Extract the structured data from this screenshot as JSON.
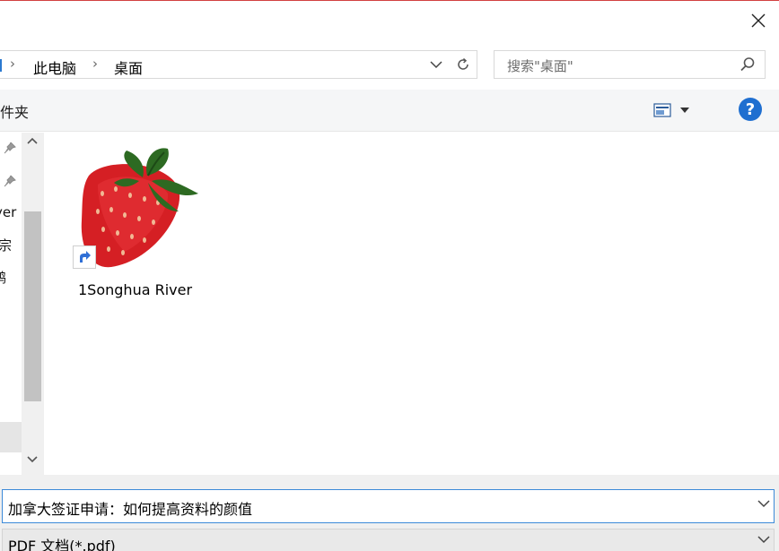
{
  "window": {
    "close_label": "×"
  },
  "address_bar": {
    "breadcrumbs": [
      "此电脑",
      "桌面"
    ]
  },
  "search": {
    "placeholder": "搜索\"桌面\""
  },
  "toolbar": {
    "new_folder_label": "件夹",
    "help_label": "?"
  },
  "nav": {
    "items": [
      "yer",
      "宗",
      "鸭"
    ]
  },
  "files": [
    {
      "name": "1Songhua River",
      "icon": "strawberry-image-icon",
      "is_shortcut": true
    }
  ],
  "bottom": {
    "filename_value": "加拿大签证申请：如何提高资料的颜值",
    "filetype_value": "PDF 文档(*.pdf)"
  },
  "colors": {
    "accent": "#1f6fd0",
    "input_focus_border": "#3c8ad8",
    "title_top_line": "#d24040"
  }
}
